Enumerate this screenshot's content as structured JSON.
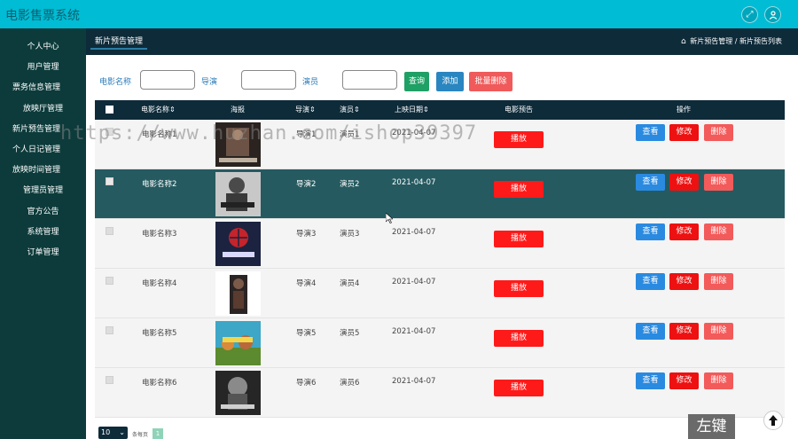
{
  "header": {
    "title": "电影售票系统",
    "expand_icon": "expand-arrows-icon",
    "user_icon": "user-icon"
  },
  "sidebar": {
    "items": [
      {
        "label": "个人中心"
      },
      {
        "label": "用户管理"
      },
      {
        "label": "票务信息管理"
      },
      {
        "label": "放映厅管理"
      },
      {
        "label": "新片预告管理"
      },
      {
        "label": "个人日记管理"
      },
      {
        "label": "放映时间管理"
      },
      {
        "label": "管理员管理"
      },
      {
        "label": "官方公告"
      },
      {
        "label": "系统管理"
      },
      {
        "label": "订单管理"
      }
    ]
  },
  "page": {
    "tab": "新片预告管理",
    "breadcrumb": {
      "level1": "新片预告管理",
      "sep": "/",
      "level2": "新片预告列表"
    }
  },
  "search": {
    "name_label": "电影名称",
    "name_value": "",
    "director_label": "导演",
    "director_value": "",
    "actor_label": "演员",
    "actor_value": "",
    "query_btn": "查询",
    "add_btn": "添加",
    "batch_delete_btn": "批量删除",
    "colors": {
      "query": "#1fa065",
      "add": "#2a86c0",
      "batch_delete": "#f05a5a"
    }
  },
  "table": {
    "headers": {
      "name": "电影名称",
      "poster": "海报",
      "director": "导演",
      "actor": "演员",
      "date": "上映日期",
      "preview": "电影预告",
      "ops": "操作"
    },
    "sort_mark": "⇕",
    "rows": [
      {
        "name": "电影名称1",
        "director": "导演1",
        "actor": "演员1",
        "date": "2021-04-07",
        "highlighted": false
      },
      {
        "name": "电影名称2",
        "director": "导演2",
        "actor": "演员2",
        "date": "2021-04-07",
        "highlighted": true
      },
      {
        "name": "电影名称3",
        "director": "导演3",
        "actor": "演员3",
        "date": "2021-04-07",
        "highlighted": false
      },
      {
        "name": "电影名称4",
        "director": "导演4",
        "actor": "演员4",
        "date": "2021-04-07",
        "highlighted": false
      },
      {
        "name": "电影名称5",
        "director": "导演5",
        "actor": "演员5",
        "date": "2021-04-07",
        "highlighted": false
      },
      {
        "name": "电影名称6",
        "director": "导演6",
        "actor": "演员6",
        "date": "2021-04-07",
        "highlighted": false
      }
    ],
    "row_actions": {
      "play": "播放",
      "view": "查看",
      "edit": "修改",
      "delete": "删除"
    },
    "colors": {
      "play": "#ff1a1a",
      "view": "#2a8ae0",
      "edit": "#ee1111",
      "delete": "#f35a5a"
    }
  },
  "pager": {
    "page_size": "10",
    "per_page_text": "条每页",
    "current_page": "1"
  },
  "overlay": {
    "watermark": "https://www.huzhan.com/ishop39397",
    "mouse_key_label": "左键",
    "scroll_top_icon": "arrow-up-icon"
  }
}
